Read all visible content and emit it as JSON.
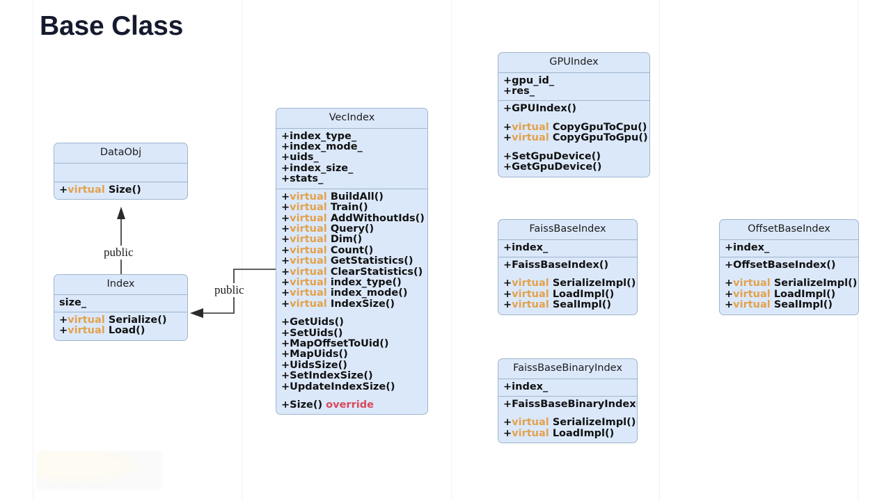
{
  "slide": {
    "title": "Base Class",
    "background": "#ffffff",
    "colors": {
      "box_fill": "#dbe8fa",
      "box_border": "#9fb4cc",
      "title_text": "#161a2e",
      "virtual_keyword": "#e2a24c",
      "override_keyword": "#d9485c",
      "member_text": "#111111",
      "connector": "#2b2b2b"
    }
  },
  "classes": {
    "dataobj": {
      "name": "DataObj",
      "attributes": [],
      "methods": [
        {
          "visibility": "+",
          "virtual": "virtual",
          "name": "Size()"
        }
      ]
    },
    "index": {
      "name": "Index",
      "attributes": [
        {
          "visibility": "",
          "name": "size_"
        }
      ],
      "methods": [
        {
          "visibility": "+",
          "virtual": "virtual",
          "name": "Serialize()"
        },
        {
          "visibility": "+",
          "virtual": "virtual",
          "name": "Load()"
        }
      ]
    },
    "vecindex": {
      "name": "VecIndex",
      "attributes": [
        {
          "visibility": "+",
          "name": "index_type_"
        },
        {
          "visibility": "+",
          "name": "index_mode_"
        },
        {
          "visibility": "+",
          "name": "uids_"
        },
        {
          "visibility": "+",
          "name": "index_size_"
        },
        {
          "visibility": "+",
          "name": "stats_"
        }
      ],
      "methods_virtual": [
        {
          "visibility": "+",
          "virtual": "virtual",
          "name": "BuildAll()"
        },
        {
          "visibility": "+",
          "virtual": "virtual",
          "name": "Train()"
        },
        {
          "visibility": "+",
          "virtual": "virtual",
          "name": "AddWithoutIds()"
        },
        {
          "visibility": "+",
          "virtual": "virtual",
          "name": "Query()"
        },
        {
          "visibility": "+",
          "virtual": "virtual",
          "name": "Dim()"
        },
        {
          "visibility": "+",
          "virtual": "virtual",
          "name": "Count()"
        },
        {
          "visibility": "+",
          "virtual": "virtual",
          "name": "GetStatistics()"
        },
        {
          "visibility": "+",
          "virtual": "virtual",
          "name": "ClearStatistics()"
        },
        {
          "visibility": "+",
          "virtual": "virtual",
          "name": "index_type()"
        },
        {
          "visibility": "+",
          "virtual": "virtual",
          "name": "index_mode()"
        },
        {
          "visibility": "+",
          "virtual": "virtual",
          "name": "IndexSize()"
        }
      ],
      "methods_plain": [
        {
          "visibility": "+",
          "name": "GetUids()"
        },
        {
          "visibility": "+",
          "name": "SetUids()"
        },
        {
          "visibility": "+",
          "name": "MapOffsetToUid()"
        },
        {
          "visibility": "+",
          "name": "MapUids()"
        },
        {
          "visibility": "+",
          "name": "UidsSize()"
        },
        {
          "visibility": "+",
          "name": "SetIndexSize()"
        },
        {
          "visibility": "+",
          "name": "UpdateIndexSize()"
        }
      ],
      "methods_override": [
        {
          "visibility": "+",
          "name": "Size()",
          "suffix": "override"
        }
      ]
    },
    "gpuindex": {
      "name": "GPUIndex",
      "attributes": [
        {
          "visibility": "+",
          "name": "gpu_id_"
        },
        {
          "visibility": "+",
          "name": "res_"
        }
      ],
      "constructors": [
        {
          "visibility": "+",
          "name": "GPUIndex()"
        }
      ],
      "methods_virtual": [
        {
          "visibility": "+",
          "virtual": "virtual",
          "name": "CopyGpuToCpu()"
        },
        {
          "visibility": "+",
          "virtual": "virtual",
          "name": "CopyGpuToGpu()"
        }
      ],
      "methods_plain": [
        {
          "visibility": "+",
          "name": "SetGpuDevice()"
        },
        {
          "visibility": "+",
          "name": "GetGpuDevice()"
        }
      ]
    },
    "faissbaseindex": {
      "name": "FaissBaseIndex",
      "attributes": [
        {
          "visibility": "+",
          "name": "index_"
        }
      ],
      "constructors": [
        {
          "visibility": "+",
          "name": "FaissBaseIndex()"
        }
      ],
      "methods_virtual": [
        {
          "visibility": "+",
          "virtual": "virtual",
          "name": "SerializeImpl()"
        },
        {
          "visibility": "+",
          "virtual": "virtual",
          "name": "LoadImpl()"
        },
        {
          "visibility": "+",
          "virtual": "virtual",
          "name": "SealImpl()"
        }
      ]
    },
    "offsetbaseindex": {
      "name": "OffsetBaseIndex",
      "attributes": [
        {
          "visibility": "+",
          "name": "index_"
        }
      ],
      "constructors": [
        {
          "visibility": "+",
          "name": "OffsetBaseIndex()"
        }
      ],
      "methods_virtual": [
        {
          "visibility": "+",
          "virtual": "virtual",
          "name": "SerializeImpl()"
        },
        {
          "visibility": "+",
          "virtual": "virtual",
          "name": "LoadImpl()"
        },
        {
          "visibility": "+",
          "virtual": "virtual",
          "name": "SealImpl()"
        }
      ]
    },
    "faissbasebinaryindex": {
      "name": "FaissBaseBinaryIndex",
      "attributes": [
        {
          "visibility": "+",
          "name": "index_"
        }
      ],
      "constructors": [
        {
          "visibility": "+",
          "name": "FaissBaseBinaryIndex()"
        }
      ],
      "methods_virtual": [
        {
          "visibility": "+",
          "virtual": "virtual",
          "name": "SerializeImpl()"
        },
        {
          "visibility": "+",
          "virtual": "virtual",
          "name": "LoadImpl()"
        }
      ]
    }
  },
  "connections": [
    {
      "id": "index-to-dataobj",
      "from": "Index",
      "to": "DataObj",
      "label": "public"
    },
    {
      "id": "vecindex-to-index",
      "from": "VecIndex",
      "to": "Index",
      "label": "public"
    }
  ]
}
